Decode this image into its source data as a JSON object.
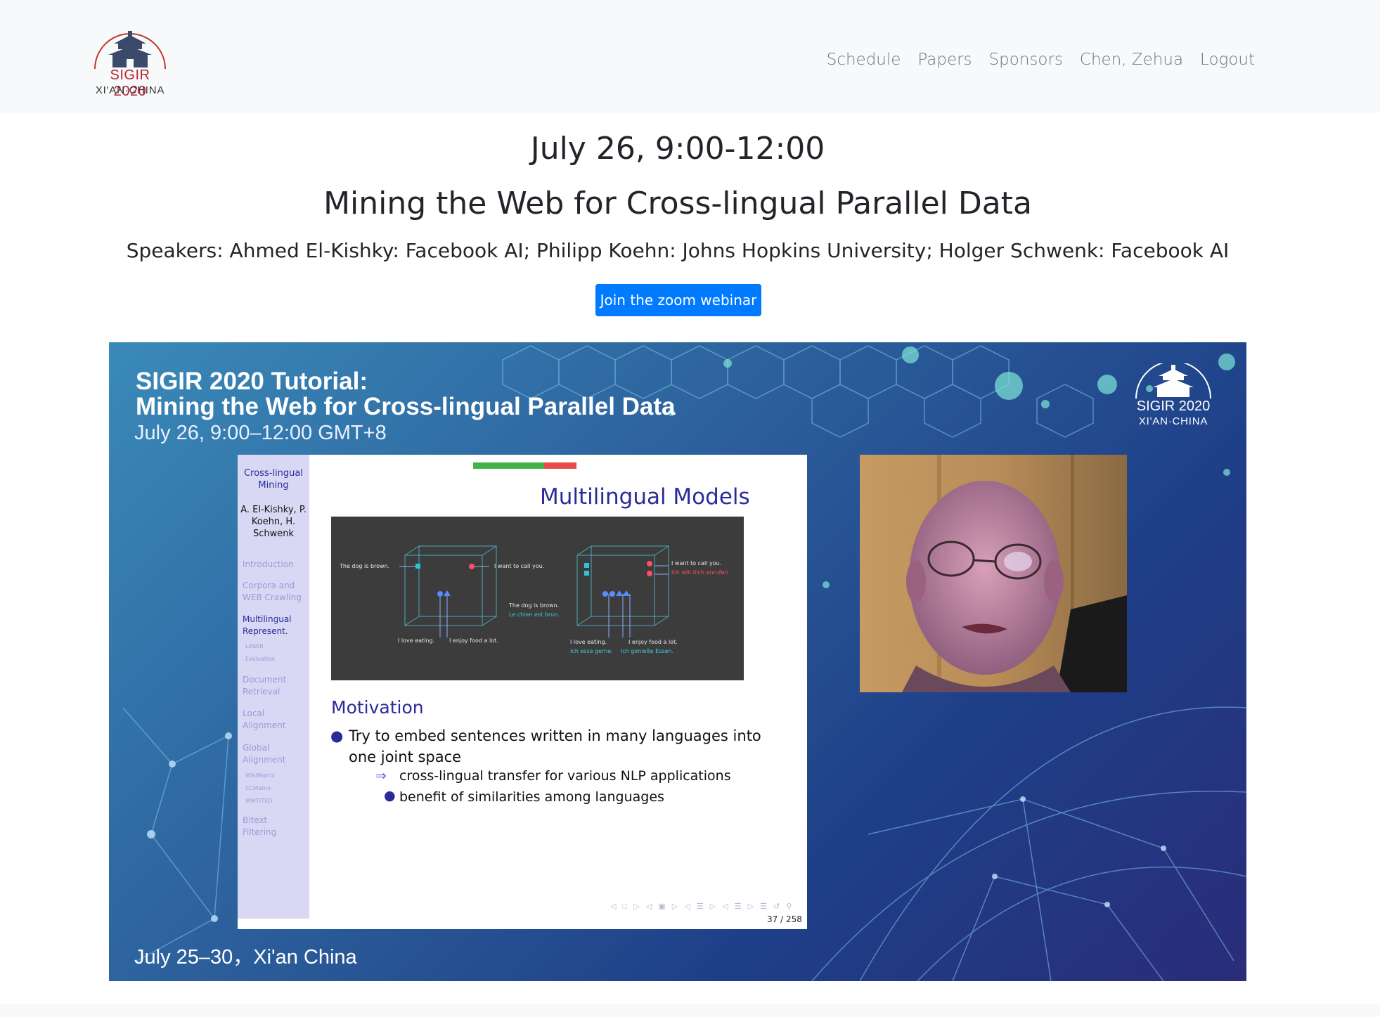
{
  "logo": {
    "name": "SIGIR 2020",
    "location": "XI'AN·CHINA"
  },
  "nav": [
    {
      "label": "Schedule"
    },
    {
      "label": "Papers"
    },
    {
      "label": "Sponsors"
    },
    {
      "label": "Chen, Zehua"
    },
    {
      "label": "Logout"
    }
  ],
  "session": {
    "date": "July 26, 9:00-12:00",
    "title": "Mining the Web for Cross-lingual Parallel Data",
    "speakers": "Speakers: Ahmed El-Kishky: Facebook AI; Philipp Koehn: Johns Hopkins University; Holger Schwenk: Facebook AI",
    "join_label": "Join the zoom webinar"
  },
  "video": {
    "title_line1": "SIGIR 2020 Tutorial:",
    "title_line2": "Mining  the Web for Cross-lingual Parallel Data",
    "time": "July 26, 9:00–12:00 GMT+8",
    "footer": "July 25–30，Xi'an China",
    "logo_name": "SIGIR 2020",
    "logo_location": "XI'AN·CHINA",
    "slide": {
      "side_title": "Cross-lingual Mining",
      "side_authors": "A. El-Kishky, P. Koehn, H. Schwenk",
      "sections": [
        {
          "label": "Introduction"
        },
        {
          "label": "Corpora and WEB Crawling"
        },
        {
          "label": "Multilingual Represent."
        },
        {
          "label": "LASER"
        },
        {
          "label": "Evaluation"
        },
        {
          "label": "Document Retrieval"
        },
        {
          "label": "Local Alignment"
        },
        {
          "label": "Global Alignment"
        },
        {
          "label": "WikiMatrix"
        },
        {
          "label": "CCMatrix"
        },
        {
          "label": "WMT/TED"
        },
        {
          "label": "Bitext Filtering"
        }
      ],
      "heading": "Multilingual Models",
      "figure": {
        "left_dog": "The dog is brown.",
        "left_call": "I want to call you.",
        "left_eat": "I love eating.",
        "left_food": "I enjoy food a lot.",
        "right_call_en": "I want to call you.",
        "right_call_de": "Ich will dich anrufen.",
        "right_dog_en": "The dog is brown.",
        "right_dog_fr": "Le chien est brun.",
        "right_eat_en": "I love eating.",
        "right_eat_de": "Ich esse gerne.",
        "right_food_en": "I enjoy food a lot.",
        "right_food_de": "Ich genieße Essen."
      },
      "motivation": "Motivation",
      "bullet_line1": "Try to embed sentences written in many languages into",
      "bullet_line2": "one joint space",
      "sub1": "cross-lingual transfer for various NLP applications",
      "sub2": "benefit of similarities among languages",
      "page": "37 / 258"
    }
  },
  "colors": {
    "primary": "#007bff",
    "slide_blue": "#2a2a9a",
    "logo_red": "#b8232f"
  }
}
